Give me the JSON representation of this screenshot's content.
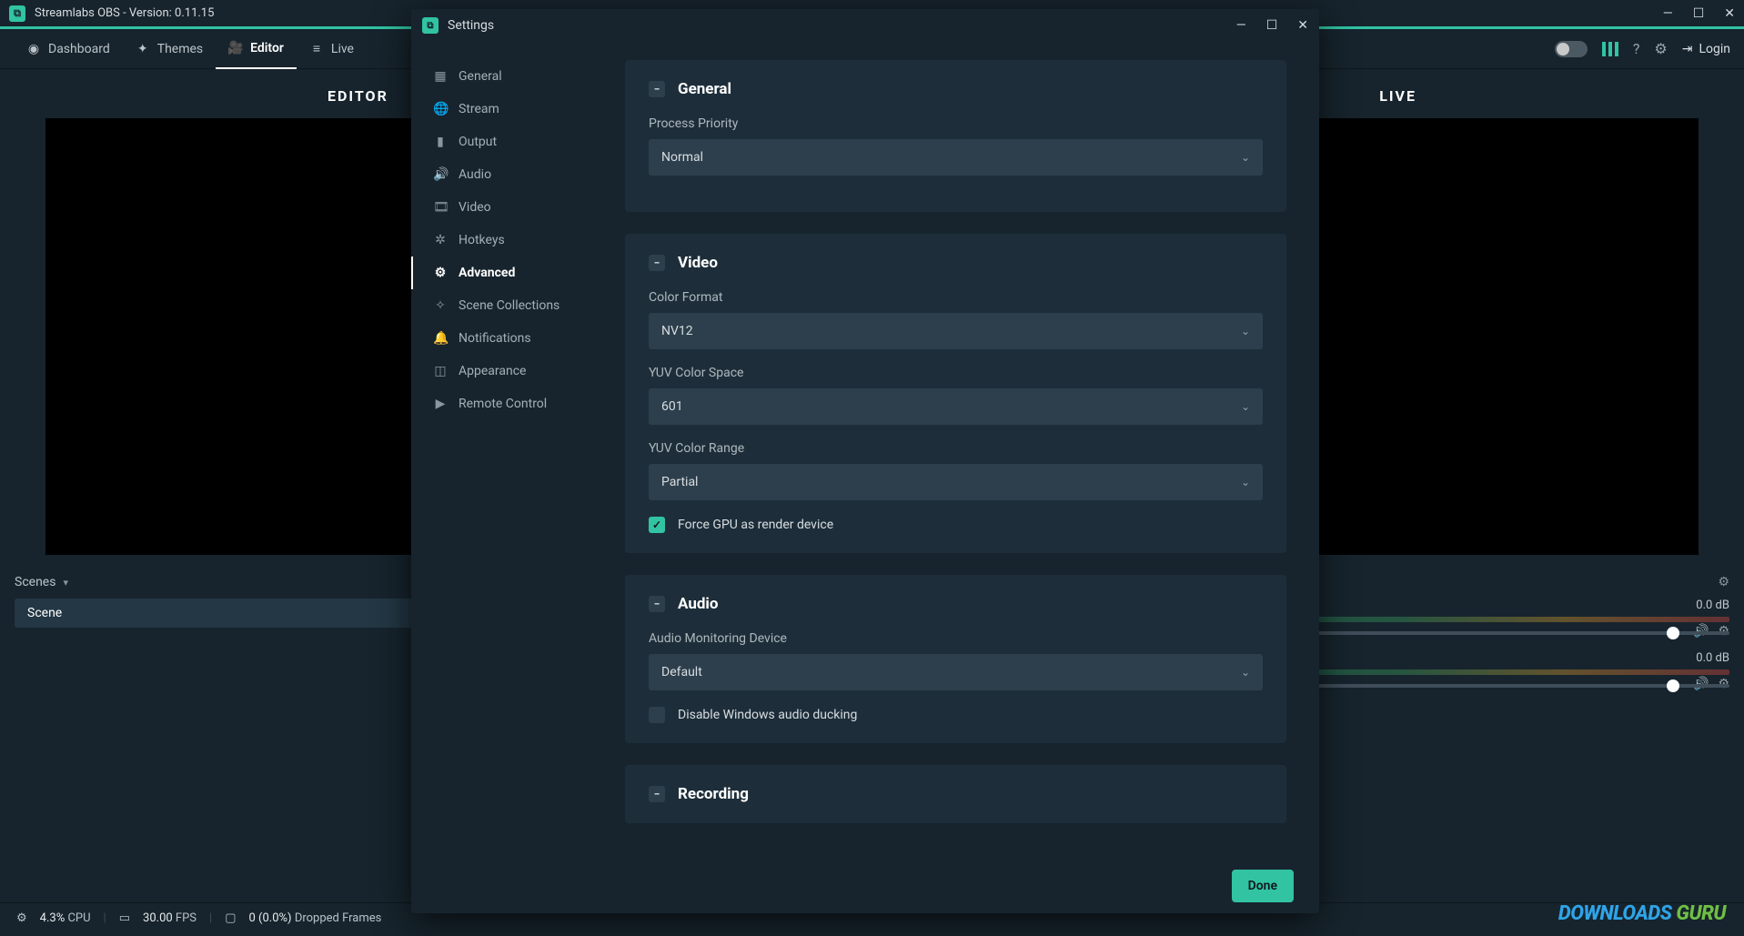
{
  "titlebar": {
    "title": "Streamlabs OBS - Version: 0.11.15"
  },
  "nav": {
    "items": [
      {
        "label": "Dashboard"
      },
      {
        "label": "Themes"
      },
      {
        "label": "Editor"
      },
      {
        "label": "Live"
      }
    ],
    "login": "Login"
  },
  "workspace": {
    "left_label": "EDITOR",
    "right_label": "LIVE",
    "scenes_label": "Scenes",
    "scene_items": [
      "Scene"
    ],
    "mixer": {
      "db": "0.0 dB"
    }
  },
  "status": {
    "cpu_value": "4.3%",
    "cpu_label": "CPU",
    "fps_value": "30.00",
    "fps_label": "FPS",
    "dropped_value": "0 (0.0%)",
    "dropped_label": "Dropped Frames"
  },
  "settings": {
    "title": "Settings",
    "done": "Done",
    "categories": [
      "General",
      "Stream",
      "Output",
      "Audio",
      "Video",
      "Hotkeys",
      "Advanced",
      "Scene Collections",
      "Notifications",
      "Appearance",
      "Remote Control"
    ],
    "active_category": "Advanced",
    "sections": {
      "general": {
        "title": "General",
        "process_priority_label": "Process Priority",
        "process_priority_value": "Normal"
      },
      "video": {
        "title": "Video",
        "color_format_label": "Color Format",
        "color_format_value": "NV12",
        "yuv_space_label": "YUV Color Space",
        "yuv_space_value": "601",
        "yuv_range_label": "YUV Color Range",
        "yuv_range_value": "Partial",
        "force_gpu_label": "Force GPU as render device"
      },
      "audio": {
        "title": "Audio",
        "monitoring_label": "Audio Monitoring Device",
        "monitoring_value": "Default",
        "ducking_label": "Disable Windows audio ducking"
      },
      "recording": {
        "title": "Recording"
      }
    }
  },
  "watermark": {
    "a": "DOWNLOADS ",
    "b": "GURU"
  }
}
